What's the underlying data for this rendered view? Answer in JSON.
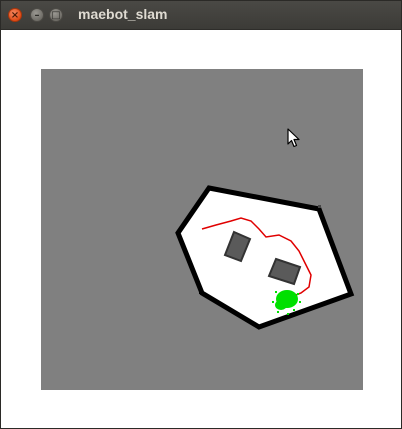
{
  "window": {
    "title": "maebot_slam",
    "buttons": {
      "close_icon": "close-icon",
      "minimize_icon": "minimize-icon",
      "maximize_icon": "maximize-icon"
    }
  },
  "map": {
    "unknown_color": "#808080",
    "free_color": "#ffffff",
    "wall_color": "#000000",
    "obstacle_color": "#555555",
    "path_color": "#e00000",
    "particles_color": "#00e000"
  },
  "pointer": {
    "icon": "mouse-pointer-icon"
  }
}
